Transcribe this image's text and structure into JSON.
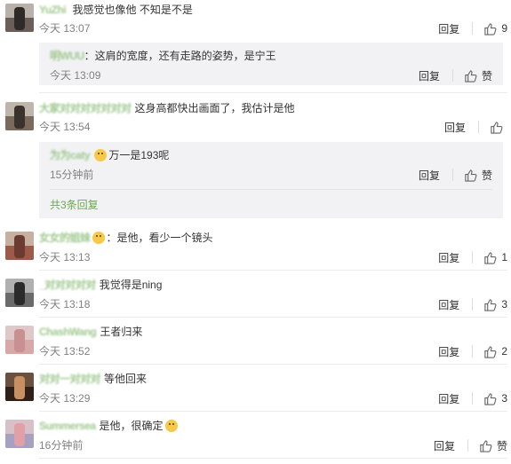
{
  "comments": [
    {
      "user": "YuZhi",
      "text": "我感觉也像他 不知是不是",
      "time": "今天 13:07",
      "reply": "回复",
      "likes": "9",
      "avatar": {
        "top": "#b9b2aa",
        "bottom": "#6a5f58",
        "mid": "#2e2a28"
      }
    },
    {
      "user": "大家对对对对对对对",
      "text": "这身高都快出画面了，我估计是他",
      "time": "今天 13:54",
      "reply": "回复",
      "likes": "",
      "avatar": {
        "top": "#bfb6ab",
        "bottom": "#7a6a5c",
        "mid": "#3a322c"
      }
    },
    {
      "user": "女女的姐妹",
      "text": "：是他，看少一个镜头",
      "time": "今天 13:13",
      "reply": "回复",
      "likes": "1",
      "avatar": {
        "top": "#c8b0a0",
        "bottom": "#9b5a4a",
        "mid": "#6b3a30"
      }
    },
    {
      "user": "_对对对对对",
      "text": "我觉得是ning",
      "time": "今天 13:18",
      "reply": "回复",
      "likes": "3",
      "avatar": {
        "top": "#b0b0b0",
        "bottom": "#6a6a6a",
        "mid": "#2a2a2a"
      }
    },
    {
      "user": "ChashWang",
      "text": "王者归来",
      "time": "今天 13:52",
      "reply": "回复",
      "likes": "2",
      "avatar": {
        "top": "#e0c8c8",
        "bottom": "#d8a8a8",
        "mid": "#c89090"
      }
    },
    {
      "user": "对对一对对对",
      "text": "等他回来",
      "time": "今天 13:29",
      "reply": "回复",
      "likes": "3",
      "avatar": {
        "top": "#6a5040",
        "bottom": "#2e2018",
        "mid": "#c89060"
      }
    },
    {
      "user": "Summersea",
      "text": "是他，很确定",
      "time": "16分钟前",
      "reply": "回复",
      "likes": "赞",
      "avatar": {
        "top": "#d8c0c8",
        "bottom": "#a8a0c0",
        "mid": "#e0a0a8"
      }
    }
  ],
  "replies": [
    {
      "user": "明WUU",
      "text": "：这肩的宽度，还有走路的姿势，是宁王",
      "time": "今天 13:09",
      "reply": "回复",
      "likes": "赞"
    },
    {
      "user": "为为caty",
      "text": "万一是193呢",
      "time": "15分钟前",
      "reply": "回复",
      "likes": "赞",
      "more": "共3条回复"
    }
  ],
  "colors": {
    "username": "#9fc88f",
    "link": "#6aa84f",
    "time": "#808080",
    "reply_bg": "#f2f2f5"
  },
  "icons": {
    "like": "thumbs-up-icon"
  }
}
